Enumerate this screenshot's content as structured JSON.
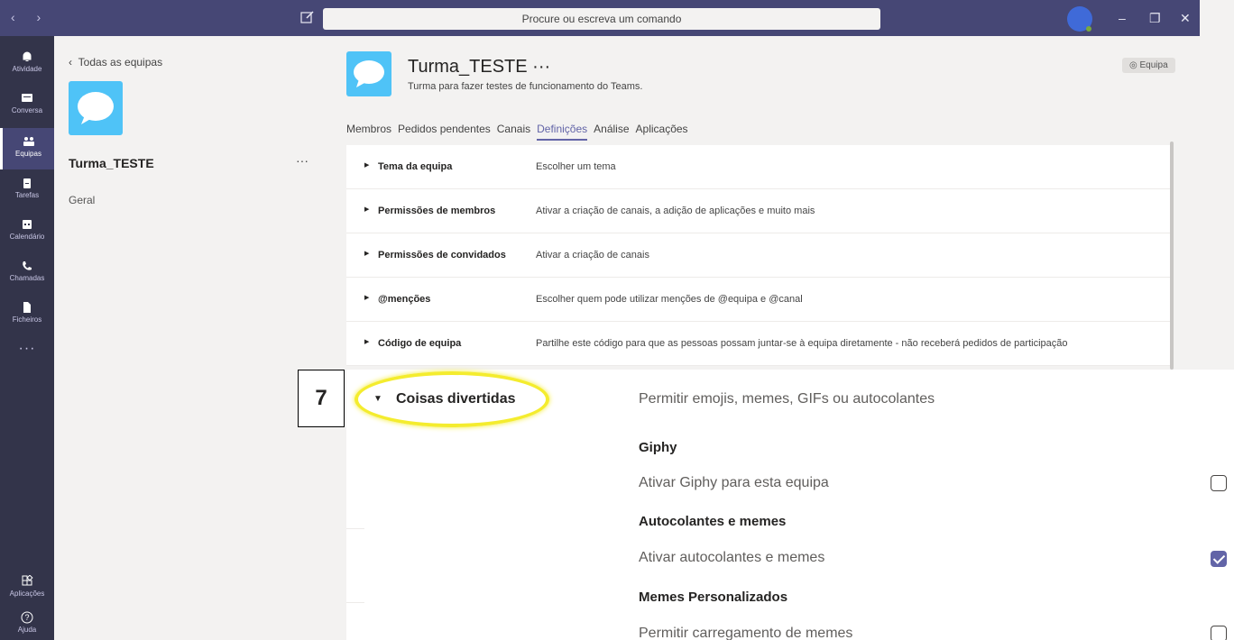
{
  "titlebar": {
    "nav_arrows": "‹  ›",
    "search_placeholder": "Procure ou escreva um comando",
    "min": "–",
    "max": "❐",
    "close": "✕"
  },
  "appbar": {
    "items": [
      {
        "label": "Atividade",
        "icon": "bell-icon"
      },
      {
        "label": "Conversa",
        "icon": "chat-icon"
      },
      {
        "label": "Equipas",
        "icon": "teams-icon"
      },
      {
        "label": "Tarefas",
        "icon": "tasks-icon"
      },
      {
        "label": "Calendário",
        "icon": "calendar-icon"
      },
      {
        "label": "Chamadas",
        "icon": "phone-icon"
      },
      {
        "label": "Ficheiros",
        "icon": "file-icon"
      }
    ],
    "more": "···",
    "bottom": [
      {
        "label": "Aplicações",
        "icon": "apps-icon"
      },
      {
        "label": "Ajuda",
        "icon": "help-icon"
      }
    ]
  },
  "teampanel": {
    "back_label": "Todas as equipas",
    "team_name": "Turma_TESTE",
    "more": "···",
    "channel": "Geral"
  },
  "main": {
    "title": "Turma_TESTE ···",
    "subtitle": "Turma para fazer testes de funcionamento do Teams.",
    "badge": "Equipa",
    "tabs": [
      "Membros",
      "Pedidos pendentes",
      "Canais",
      "Definições",
      "Análise",
      "Aplicações"
    ],
    "active_tab": 3,
    "settings": [
      {
        "name": "Tema da equipa",
        "desc": "Escolher um tema"
      },
      {
        "name": "Permissões de membros",
        "desc": "Ativar a criação de canais, a adição de aplicações e muito mais"
      },
      {
        "name": "Permissões de convidados",
        "desc": "Ativar a criação de canais"
      },
      {
        "name": "@menções",
        "desc": "Escolher quem pode utilizar menções de @equipa e @canal"
      },
      {
        "name": "Código de equipa",
        "desc": "Partilhe este código para que as pessoas possam juntar-se à equipa diretamente - não receberá pedidos de participação"
      }
    ]
  },
  "zoom": {
    "step": "7",
    "heading": "Coisas divertidas",
    "desc": "Permitir emojis, memes, GIFs ou autocolantes",
    "giphy_title": "Giphy",
    "giphy_option": "Ativar Giphy para esta equipa",
    "giphy_checked": false,
    "stickers_title": "Autocolantes e memes",
    "stickers_option": "Ativar autocolantes e memes",
    "stickers_checked": true,
    "custom_title": "Memes Personalizados",
    "custom_option": "Permitir carregamento de memes",
    "custom_checked": false
  },
  "colors": {
    "brand": "#6264a7",
    "titlebar": "#464775",
    "appbar": "#33344a",
    "highlight": "#f4ec2e"
  }
}
